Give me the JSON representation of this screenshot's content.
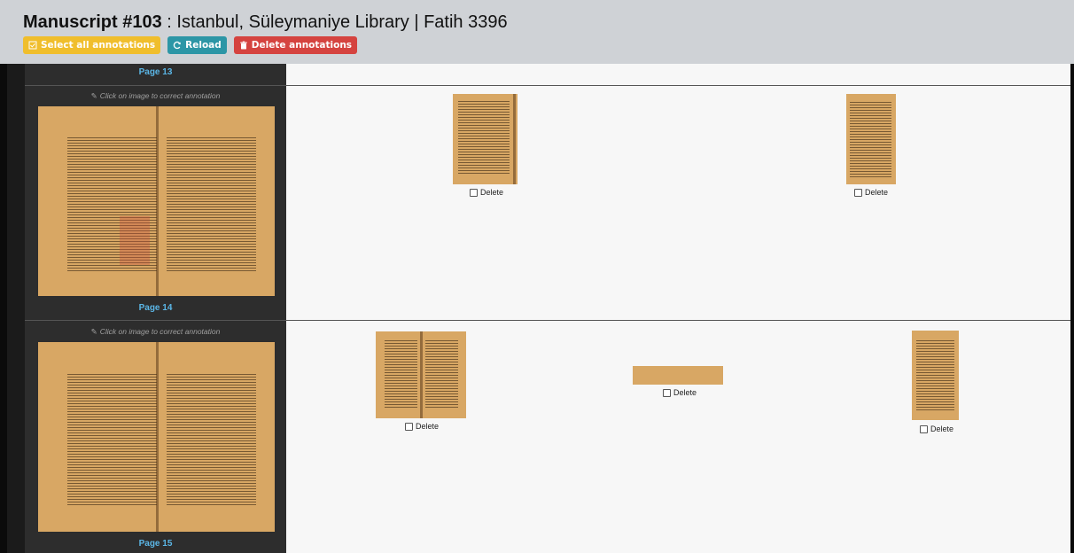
{
  "header": {
    "title_bold": "Manuscript #103",
    "title_rest": " : Istanbul, Süleymaniye Library | Fatih 3396",
    "buttons": {
      "select_all": "Select all annotations",
      "reload": "Reload",
      "delete": "Delete annotations"
    }
  },
  "pages": [
    {
      "label": "Page 13"
    },
    {
      "label": "Page 14",
      "hint": "Click on image to correct annotation",
      "annotations": [
        {
          "delete_label": "Delete"
        },
        {
          "delete_label": "Delete"
        }
      ]
    },
    {
      "label": "Page 15",
      "hint": "Click on image to correct annotation",
      "annotations": [
        {
          "delete_label": "Delete"
        },
        {
          "delete_label": "Delete"
        },
        {
          "delete_label": "Delete"
        }
      ]
    }
  ],
  "colors": {
    "header_bg": "#cfd2d6",
    "select_all": "#f0be2c",
    "reload": "#2c96a6",
    "delete": "#d5433f",
    "page_label": "#5bb6e6"
  }
}
